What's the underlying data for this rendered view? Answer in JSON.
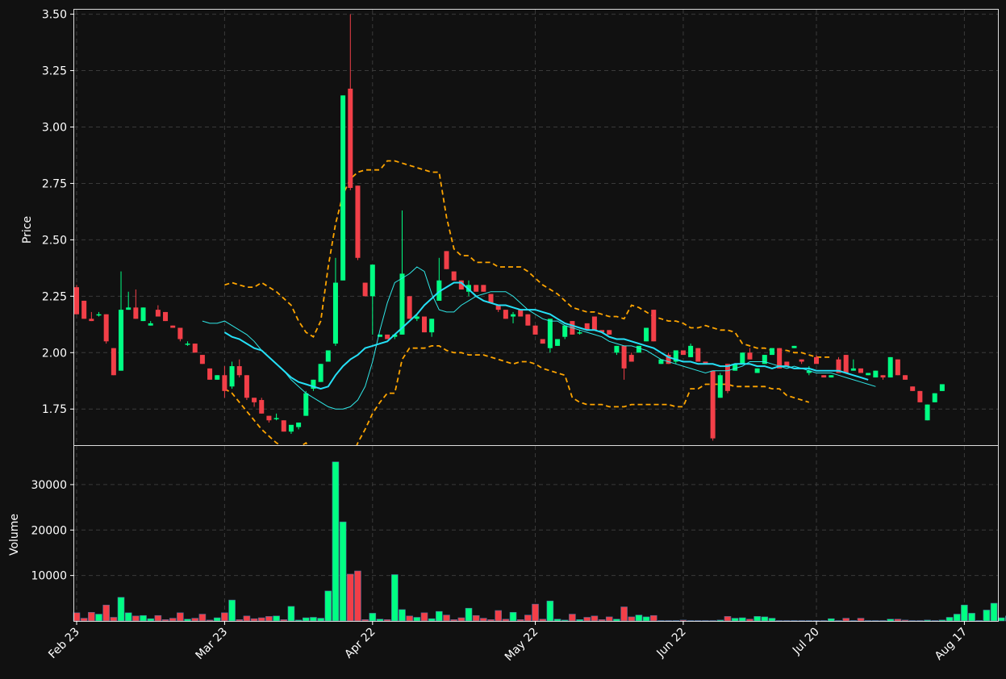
{
  "colors": {
    "background": "#111111",
    "up": "#00ff83",
    "down": "#f23f48",
    "ma_fast": "#2fe6e6",
    "ma_slow": "#25e0f7",
    "bands": "#ffa500",
    "grid": "#3a3a3a"
  },
  "chart_data": [
    {
      "type": "candlestick",
      "ylabel": "Price",
      "ylim": [
        1.59,
        3.52
      ],
      "yticks": [
        "1.75",
        "2.00",
        "2.25",
        "2.50",
        "2.75",
        "3.00",
        "3.25",
        "3.50"
      ],
      "grid": true,
      "candles": [
        {
          "o": 2.29,
          "h": 2.3,
          "l": 2.17,
          "c": 2.17
        },
        {
          "o": 2.23,
          "h": 2.23,
          "l": 2.15,
          "c": 2.15
        },
        {
          "o": 2.15,
          "h": 2.18,
          "l": 2.14,
          "c": 2.14
        },
        {
          "o": 2.17,
          "h": 2.18,
          "l": 2.16,
          "c": 2.17
        },
        {
          "o": 2.17,
          "h": 2.17,
          "l": 2.04,
          "c": 2.05
        },
        {
          "o": 2.02,
          "h": 2.02,
          "l": 1.9,
          "c": 1.9
        },
        {
          "o": 1.92,
          "h": 2.36,
          "l": 1.92,
          "c": 2.19
        },
        {
          "o": 2.19,
          "h": 2.27,
          "l": 2.19,
          "c": 2.2
        },
        {
          "o": 2.2,
          "h": 2.28,
          "l": 2.15,
          "c": 2.15
        },
        {
          "o": 2.14,
          "h": 2.2,
          "l": 2.14,
          "c": 2.2
        },
        {
          "o": 2.12,
          "h": 2.14,
          "l": 2.12,
          "c": 2.13
        },
        {
          "o": 2.19,
          "h": 2.21,
          "l": 2.16,
          "c": 2.16
        },
        {
          "o": 2.18,
          "h": 2.18,
          "l": 2.14,
          "c": 2.14
        },
        {
          "o": 2.12,
          "h": 2.12,
          "l": 2.11,
          "c": 2.11
        },
        {
          "o": 2.11,
          "h": 2.11,
          "l": 2.05,
          "c": 2.06
        },
        {
          "o": 2.04,
          "h": 2.05,
          "l": 2.03,
          "c": 2.04
        },
        {
          "o": 2.04,
          "h": 2.04,
          "l": 2.0,
          "c": 2.0
        },
        {
          "o": 1.99,
          "h": 1.99,
          "l": 1.95,
          "c": 1.95
        },
        {
          "o": 1.93,
          "h": 1.93,
          "l": 1.88,
          "c": 1.88
        },
        {
          "o": 1.88,
          "h": 1.9,
          "l": 1.88,
          "c": 1.9
        },
        {
          "o": 1.9,
          "h": 1.94,
          "l": 1.8,
          "c": 1.83
        },
        {
          "o": 1.85,
          "h": 1.96,
          "l": 1.84,
          "c": 1.94
        },
        {
          "o": 1.94,
          "h": 1.97,
          "l": 1.89,
          "c": 1.9
        },
        {
          "o": 1.9,
          "h": 1.9,
          "l": 1.79,
          "c": 1.8
        },
        {
          "o": 1.8,
          "h": 1.8,
          "l": 1.76,
          "c": 1.78
        },
        {
          "o": 1.79,
          "h": 1.8,
          "l": 1.73,
          "c": 1.73
        },
        {
          "o": 1.72,
          "h": 1.72,
          "l": 1.69,
          "c": 1.7
        },
        {
          "o": 1.71,
          "h": 1.73,
          "l": 1.7,
          "c": 1.71
        },
        {
          "o": 1.7,
          "h": 1.7,
          "l": 1.65,
          "c": 1.65
        },
        {
          "o": 1.65,
          "h": 1.67,
          "l": 1.64,
          "c": 1.68
        },
        {
          "o": 1.67,
          "h": 1.69,
          "l": 1.66,
          "c": 1.69
        },
        {
          "o": 1.72,
          "h": 1.83,
          "l": 1.72,
          "c": 1.82
        },
        {
          "o": 1.84,
          "h": 1.88,
          "l": 1.83,
          "c": 1.88
        },
        {
          "o": 1.87,
          "h": 1.95,
          "l": 1.87,
          "c": 1.95
        },
        {
          "o": 1.96,
          "h": 2.01,
          "l": 1.96,
          "c": 2.01
        },
        {
          "o": 2.04,
          "h": 2.42,
          "l": 2.03,
          "c": 2.31
        },
        {
          "o": 2.32,
          "h": 3.14,
          "l": 2.32,
          "c": 3.14
        },
        {
          "o": 3.17,
          "h": 3.5,
          "l": 2.72,
          "c": 2.73
        },
        {
          "o": 2.74,
          "h": 2.74,
          "l": 2.41,
          "c": 2.42
        },
        {
          "o": 2.31,
          "h": 2.31,
          "l": 2.25,
          "c": 2.25
        },
        {
          "o": 2.25,
          "h": 2.39,
          "l": 2.08,
          "c": 2.39
        },
        {
          "o": 2.07,
          "h": 2.08,
          "l": 2.07,
          "c": 2.08
        },
        {
          "o": 2.08,
          "h": 2.08,
          "l": 2.06,
          "c": 2.06
        },
        {
          "o": 2.07,
          "h": 2.08,
          "l": 2.06,
          "c": 2.08
        },
        {
          "o": 2.08,
          "h": 2.63,
          "l": 2.08,
          "c": 2.35
        },
        {
          "o": 2.25,
          "h": 2.25,
          "l": 2.15,
          "c": 2.15
        },
        {
          "o": 2.15,
          "h": 2.17,
          "l": 2.14,
          "c": 2.16
        },
        {
          "o": 2.16,
          "h": 2.16,
          "l": 2.09,
          "c": 2.09
        },
        {
          "o": 2.09,
          "h": 2.15,
          "l": 2.07,
          "c": 2.15
        },
        {
          "o": 2.23,
          "h": 2.42,
          "l": 2.23,
          "c": 2.32
        },
        {
          "o": 2.45,
          "h": 2.45,
          "l": 2.37,
          "c": 2.37
        },
        {
          "o": 2.36,
          "h": 2.36,
          "l": 2.32,
          "c": 2.32
        },
        {
          "o": 2.32,
          "h": 2.32,
          "l": 2.28,
          "c": 2.28
        },
        {
          "o": 2.27,
          "h": 2.32,
          "l": 2.25,
          "c": 2.3
        },
        {
          "o": 2.3,
          "h": 2.3,
          "l": 2.27,
          "c": 2.27
        },
        {
          "o": 2.3,
          "h": 2.3,
          "l": 2.27,
          "c": 2.27
        },
        {
          "o": 2.26,
          "h": 2.26,
          "l": 2.22,
          "c": 2.22
        },
        {
          "o": 2.21,
          "h": 2.21,
          "l": 2.18,
          "c": 2.19
        },
        {
          "o": 2.19,
          "h": 2.19,
          "l": 2.15,
          "c": 2.15
        },
        {
          "o": 2.16,
          "h": 2.18,
          "l": 2.13,
          "c": 2.17
        },
        {
          "o": 2.19,
          "h": 2.19,
          "l": 2.16,
          "c": 2.16
        },
        {
          "o": 2.17,
          "h": 2.17,
          "l": 2.12,
          "c": 2.12
        },
        {
          "o": 2.12,
          "h": 2.12,
          "l": 2.08,
          "c": 2.08
        },
        {
          "o": 2.06,
          "h": 2.06,
          "l": 2.04,
          "c": 2.04
        },
        {
          "o": 2.02,
          "h": 2.15,
          "l": 2.0,
          "c": 2.15
        },
        {
          "o": 2.03,
          "h": 2.06,
          "l": 2.03,
          "c": 2.06
        },
        {
          "o": 2.07,
          "h": 2.12,
          "l": 2.06,
          "c": 2.12
        },
        {
          "o": 2.14,
          "h": 2.14,
          "l": 2.08,
          "c": 2.08
        },
        {
          "o": 2.09,
          "h": 2.1,
          "l": 2.08,
          "c": 2.09
        },
        {
          "o": 2.13,
          "h": 2.13,
          "l": 2.1,
          "c": 2.1
        },
        {
          "o": 2.16,
          "h": 2.16,
          "l": 2.1,
          "c": 2.1
        },
        {
          "o": 2.1,
          "h": 2.1,
          "l": 2.09,
          "c": 2.09
        },
        {
          "o": 2.1,
          "h": 2.1,
          "l": 2.08,
          "c": 2.08
        },
        {
          "o": 2.0,
          "h": 2.03,
          "l": 1.99,
          "c": 2.03
        },
        {
          "o": 2.03,
          "h": 2.03,
          "l": 1.88,
          "c": 1.93
        },
        {
          "o": 1.99,
          "h": 2.0,
          "l": 1.96,
          "c": 1.96
        },
        {
          "o": 2.0,
          "h": 2.03,
          "l": 2.0,
          "c": 2.03
        },
        {
          "o": 2.05,
          "h": 2.11,
          "l": 2.05,
          "c": 2.11
        },
        {
          "o": 2.19,
          "h": 2.19,
          "l": 2.05,
          "c": 2.05
        },
        {
          "o": 1.95,
          "h": 1.97,
          "l": 1.95,
          "c": 1.97
        },
        {
          "o": 1.99,
          "h": 2.0,
          "l": 1.95,
          "c": 1.95
        },
        {
          "o": 1.96,
          "h": 2.01,
          "l": 1.95,
          "c": 2.01
        },
        {
          "o": 2.01,
          "h": 2.01,
          "l": 1.99,
          "c": 1.99
        },
        {
          "o": 1.98,
          "h": 2.04,
          "l": 1.98,
          "c": 2.03
        },
        {
          "o": 2.02,
          "h": 2.02,
          "l": 1.96,
          "c": 1.96
        },
        {
          "o": 1.96,
          "h": 1.96,
          "l": 1.95,
          "c": 1.95
        },
        {
          "o": 1.92,
          "h": 1.92,
          "l": 1.61,
          "c": 1.62
        },
        {
          "o": 1.8,
          "h": 1.91,
          "l": 1.8,
          "c": 1.9
        },
        {
          "o": 1.95,
          "h": 1.95,
          "l": 1.82,
          "c": 1.83
        },
        {
          "o": 1.92,
          "h": 1.95,
          "l": 1.92,
          "c": 1.95
        },
        {
          "o": 1.95,
          "h": 2.0,
          "l": 1.95,
          "c": 2.0
        },
        {
          "o": 2.0,
          "h": 2.02,
          "l": 1.97,
          "c": 1.97
        },
        {
          "o": 1.91,
          "h": 1.93,
          "l": 1.91,
          "c": 1.93
        },
        {
          "o": 1.95,
          "h": 1.99,
          "l": 1.95,
          "c": 1.99
        },
        {
          "o": 1.99,
          "h": 2.02,
          "l": 1.99,
          "c": 2.02
        },
        {
          "o": 2.02,
          "h": 2.02,
          "l": 1.93,
          "c": 1.93
        },
        {
          "o": 1.96,
          "h": 1.96,
          "l": 1.94,
          "c": 1.94
        },
        {
          "o": 2.02,
          "h": 2.03,
          "l": 2.02,
          "c": 2.03
        },
        {
          "o": 1.97,
          "h": 1.97,
          "l": 1.95,
          "c": 1.96
        },
        {
          "o": 1.91,
          "h": 1.94,
          "l": 1.9,
          "c": 1.92
        },
        {
          "o": 1.98,
          "h": 1.99,
          "l": 1.95,
          "c": 1.95
        },
        {
          "o": 1.9,
          "h": 1.9,
          "l": 1.89,
          "c": 1.89
        },
        {
          "o": 1.89,
          "h": 1.9,
          "l": 1.89,
          "c": 1.9
        },
        {
          "o": 1.97,
          "h": 1.98,
          "l": 1.91,
          "c": 1.91
        },
        {
          "o": 1.99,
          "h": 1.99,
          "l": 1.91,
          "c": 1.91
        },
        {
          "o": 1.92,
          "h": 1.97,
          "l": 1.92,
          "c": 1.93
        },
        {
          "o": 1.93,
          "h": 1.93,
          "l": 1.91,
          "c": 1.91
        },
        {
          "o": 1.9,
          "h": 1.91,
          "l": 1.9,
          "c": 1.91
        },
        {
          "o": 1.89,
          "h": 1.92,
          "l": 1.89,
          "c": 1.92
        },
        {
          "o": 1.9,
          "h": 1.9,
          "l": 1.88,
          "c": 1.89
        },
        {
          "o": 1.89,
          "h": 1.98,
          "l": 1.89,
          "c": 1.98
        },
        {
          "o": 1.97,
          "h": 1.97,
          "l": 1.9,
          "c": 1.9
        },
        {
          "o": 1.9,
          "h": 1.9,
          "l": 1.88,
          "c": 1.88
        },
        {
          "o": 1.85,
          "h": 1.85,
          "l": 1.83,
          "c": 1.83
        },
        {
          "o": 1.83,
          "h": 1.83,
          "l": 1.78,
          "c": 1.78
        },
        {
          "o": 1.7,
          "h": 1.77,
          "l": 1.7,
          "c": 1.77
        },
        {
          "o": 1.78,
          "h": 1.82,
          "l": 1.78,
          "c": 1.82
        },
        {
          "o": 1.83,
          "h": 1.86,
          "l": 1.83,
          "c": 1.86
        }
      ],
      "ma_fast": [
        2.14,
        2.13,
        2.13,
        2.14,
        2.12,
        2.1,
        2.08,
        2.05,
        2.01,
        1.98,
        1.95,
        1.92,
        1.88,
        1.85,
        1.82,
        1.8,
        1.78,
        1.76,
        1.75,
        1.75,
        1.76,
        1.79,
        1.85,
        1.96,
        2.1,
        2.22,
        2.31,
        2.33,
        2.35,
        2.38,
        2.36,
        2.26,
        2.19,
        2.18,
        2.18,
        2.21,
        2.23,
        2.25,
        2.26,
        2.27,
        2.27,
        2.27,
        2.25,
        2.22,
        2.19,
        2.17,
        2.15,
        2.14,
        2.14,
        2.12,
        2.11,
        2.1,
        2.09,
        2.08,
        2.07,
        2.05,
        2.04,
        2.03,
        2.03,
        2.02,
        2.01,
        1.99,
        1.97,
        1.96,
        1.95,
        1.94,
        1.93,
        1.92,
        1.91,
        1.92,
        1.92,
        1.92,
        1.93,
        1.94,
        1.96,
        1.96,
        1.96,
        1.95,
        1.94,
        1.93,
        1.94,
        1.93,
        1.92,
        1.91,
        1.91,
        1.91,
        1.9,
        1.89,
        1.88,
        1.87,
        1.86,
        1.85
      ],
      "ma_fast_start": 17,
      "ma_slow": [
        2.09,
        2.07,
        2.06,
        2.04,
        2.02,
        2.01,
        1.98,
        1.95,
        1.92,
        1.89,
        1.87,
        1.86,
        1.85,
        1.84,
        1.85,
        1.9,
        1.94,
        1.97,
        1.99,
        2.02,
        2.03,
        2.04,
        2.05,
        2.08,
        2.11,
        2.14,
        2.17,
        2.21,
        2.24,
        2.27,
        2.29,
        2.31,
        2.31,
        2.28,
        2.25,
        2.23,
        2.22,
        2.21,
        2.21,
        2.2,
        2.19,
        2.19,
        2.19,
        2.18,
        2.17,
        2.15,
        2.13,
        2.12,
        2.11,
        2.1,
        2.1,
        2.09,
        2.07,
        2.06,
        2.06,
        2.05,
        2.04,
        2.03,
        2.02,
        2.0,
        1.98,
        1.97,
        1.96,
        1.96,
        1.95,
        1.95,
        1.95,
        1.94,
        1.94,
        1.95,
        1.95,
        1.95,
        1.94,
        1.94,
        1.93,
        1.94,
        1.94,
        1.93,
        1.93,
        1.93,
        1.92,
        1.92,
        1.92,
        1.92,
        1.91,
        1.9,
        1.89,
        1.88
      ],
      "ma_slow_start": 20,
      "band_upper": [
        2.3,
        2.31,
        2.3,
        2.29,
        2.29,
        2.31,
        2.29,
        2.27,
        2.24,
        2.21,
        2.14,
        2.09,
        2.07,
        2.14,
        2.38,
        2.57,
        2.7,
        2.77,
        2.8,
        2.81,
        2.81,
        2.81,
        2.85,
        2.85,
        2.84,
        2.83,
        2.82,
        2.81,
        2.8,
        2.8,
        2.6,
        2.46,
        2.43,
        2.43,
        2.4,
        2.4,
        2.4,
        2.38,
        2.38,
        2.38,
        2.38,
        2.36,
        2.33,
        2.3,
        2.28,
        2.26,
        2.23,
        2.2,
        2.19,
        2.18,
        2.18,
        2.17,
        2.16,
        2.16,
        2.15,
        2.21,
        2.2,
        2.18,
        2.16,
        2.15,
        2.14,
        2.14,
        2.13,
        2.11,
        2.11,
        2.12,
        2.11,
        2.1,
        2.1,
        2.09,
        2.04,
        2.03,
        2.02,
        2.02,
        2.01,
        2.01,
        2.01,
        2.0,
        2.0,
        1.99,
        1.98,
        1.98,
        1.98
      ],
      "band_upper_start": 20,
      "band_lower": [
        1.84,
        1.82,
        1.78,
        1.74,
        1.7,
        1.66,
        1.63,
        1.6,
        1.58,
        1.57,
        1.58,
        1.6,
        1.55,
        1.5,
        1.45,
        1.45,
        1.5,
        1.52,
        1.6,
        1.66,
        1.73,
        1.78,
        1.82,
        1.82,
        1.97,
        2.02,
        2.02,
        2.02,
        2.03,
        2.03,
        2.01,
        2.0,
        2.0,
        1.99,
        1.99,
        1.99,
        1.98,
        1.97,
        1.96,
        1.95,
        1.96,
        1.96,
        1.95,
        1.93,
        1.92,
        1.91,
        1.9,
        1.8,
        1.78,
        1.77,
        1.77,
        1.77,
        1.76,
        1.76,
        1.76,
        1.77,
        1.77,
        1.77,
        1.77,
        1.77,
        1.77,
        1.76,
        1.76,
        1.84,
        1.84,
        1.86,
        1.86,
        1.86,
        1.86,
        1.85,
        1.85,
        1.85,
        1.85,
        1.85,
        1.84,
        1.84,
        1.81,
        1.8,
        1.79,
        1.78
      ],
      "band_lower_start": 20
    },
    {
      "type": "bar",
      "ylabel": "Volume",
      "ylim": [
        0,
        38500
      ],
      "yticks": [
        "10000",
        "20000",
        "30000"
      ],
      "xticks": [
        "Feb 23",
        "Mar 23",
        "Apr 22",
        "May 22",
        "Jun 22",
        "Jul 20",
        "Aug 17"
      ],
      "xtick_index": [
        0,
        20,
        40,
        62,
        82,
        100,
        120
      ],
      "volumes": [
        1800,
        600,
        1900,
        1500,
        3500,
        800,
        5200,
        1800,
        1100,
        1200,
        500,
        1200,
        300,
        600,
        1800,
        400,
        600,
        1500,
        200,
        700,
        1800,
        4600,
        300,
        1100,
        500,
        700,
        1000,
        1100,
        300,
        3200,
        200,
        700,
        800,
        600,
        6600,
        35000,
        21800,
        10300,
        11000,
        300,
        1700,
        400,
        300,
        10200,
        2500,
        1100,
        800,
        1800,
        500,
        2100,
        1300,
        300,
        700,
        2800,
        1200,
        600,
        300,
        2300,
        400,
        1900,
        300,
        1300,
        3700,
        400,
        4400,
        400,
        200,
        1500,
        300,
        800,
        1100,
        300,
        900,
        400,
        3100,
        900,
        1300,
        900,
        1200,
        100,
        100,
        100,
        200,
        100,
        100,
        100,
        100,
        200,
        1000,
        600,
        700,
        400,
        1000,
        900,
        600,
        100,
        100,
        100,
        100,
        100,
        100,
        100,
        500,
        100,
        600,
        100,
        600,
        100,
        100,
        100,
        400,
        400,
        200,
        100,
        100,
        200,
        100,
        200,
        800,
        1500,
        3500,
        1700,
        100,
        2400,
        3900,
        700,
        1100
      ]
    }
  ]
}
